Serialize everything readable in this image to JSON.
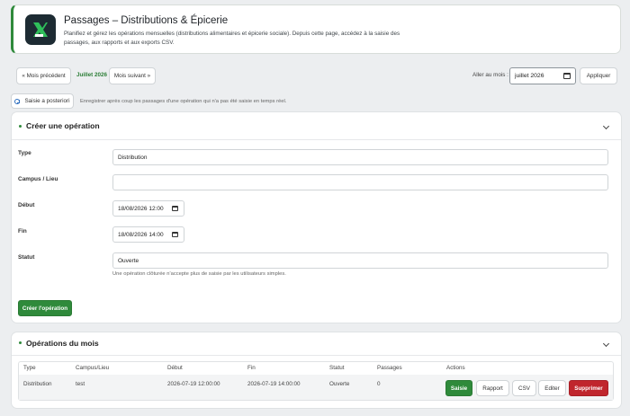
{
  "header": {
    "title": "Passages – Distributions & Épicerie",
    "description": "Planifiez et gérez les opérations mensuelles (distributions alimentaires et épicerie sociale). Depuis cette page, accédez à la saisie des passages, aux rapports et aux exports CSV.",
    "logo_icon": "logo-icon",
    "accent": "#2f8a3b"
  },
  "month_nav": {
    "prev_label": "« Mois précédent",
    "current_label": "Juillet 2026",
    "next_label": "Mois suivant »",
    "goto_label": "Aller au mois :",
    "month_value": "juillet 2026",
    "apply_label": "Appliquer"
  },
  "late_entry": {
    "button_label": "Saisie a posteriori",
    "note": "Enregistrer après coup les passages d'une opération qui n'a pas été saisie en temps réel."
  },
  "create_form": {
    "title": "Créer une opération",
    "type_label": "Type",
    "type_value": "Distribution",
    "campus_label": "Campus / Lieu",
    "campus_value": "",
    "start_label": "Début",
    "start_value": "18/08/2026 12:00",
    "end_label": "Fin",
    "end_value": "18/08/2026 14:00",
    "status_label": "Statut",
    "status_value": "Ouverte",
    "status_hint": "Une opération clôturée n'accepte plus de saisie par les utilisateurs simples.",
    "submit_label": "Créer l'opération"
  },
  "operations": {
    "title": "Opérations du mois",
    "columns": [
      "Type",
      "Campus/Lieu",
      "Début",
      "Fin",
      "Statut",
      "Passages",
      "Actions"
    ],
    "rows": [
      {
        "type": "Distribution",
        "campus": "test",
        "start": "2026-07-19 12:00:00",
        "end": "2026-07-19 14:00:00",
        "status": "Ouverte",
        "passages": "0",
        "actions": {
          "entry": "Saisie",
          "report": "Rapport",
          "csv": "CSV",
          "edit": "Editer",
          "delete": "Supprimer"
        }
      }
    ]
  },
  "colors": {
    "primary": "#2f8a3b",
    "danger": "#c0262d",
    "logo_bg": "#1d2b33"
  }
}
